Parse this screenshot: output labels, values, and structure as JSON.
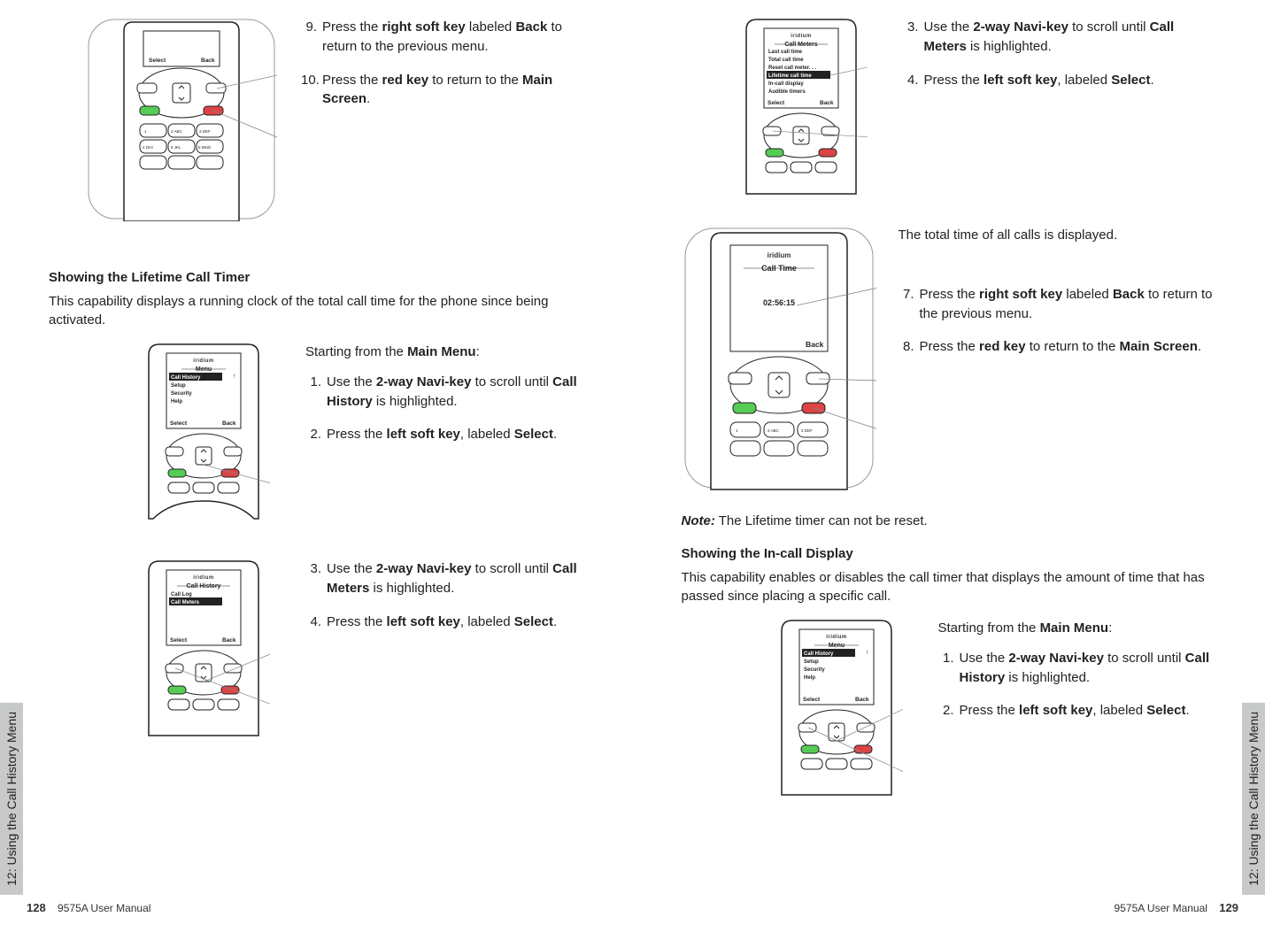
{
  "sideTab": "12: Using the Call History Menu",
  "manualTitle": "9575A User Manual",
  "pageLeftNum": "128",
  "pageRightNum": "129",
  "brand": "iridium",
  "softSelect": "Select",
  "softBack": "Back",
  "left": {
    "topPhone": {
      "step9": {
        "num": "9.",
        "pre": "Press the ",
        "b1": "right soft key",
        "mid": " labeled ",
        "b2": "Back",
        "post": " to return to the previous menu."
      },
      "step10": {
        "num": "10.",
        "pre": "Press the ",
        "b1": "red key",
        "mid": " to return to the ",
        "b2": "Main Screen",
        "post": "."
      }
    },
    "section1Title": "Showing the Lifetime Call Timer",
    "section1Body": "This capability displays a running clock of the total call time for the phone since being activated.",
    "menuTitle": "Menu",
    "menuItems": [
      "Call History",
      "Setup",
      "Security",
      "Help"
    ],
    "callHistoryTitle": "Call History",
    "callHistoryItems": [
      "Call Log",
      "Call Meters"
    ],
    "steps1": {
      "lead": {
        "pre": "Starting from the ",
        "b": "Main Menu",
        "post": ":"
      },
      "s1": {
        "num": "1.",
        "pre": "Use the ",
        "b1": "2-way Navi-key",
        "mid": " to scroll until ",
        "b2": "Call History",
        "post": " is highlighted."
      },
      "s2": {
        "num": "2.",
        "pre": "Press the ",
        "b1": "left soft key",
        "mid": ", labeled ",
        "b2": "Select",
        "post": "."
      }
    },
    "steps2": {
      "s3": {
        "num": "3.",
        "pre": "Use the ",
        "b1": "2-way Navi-key",
        "mid": " to scroll until ",
        "b2": "Call Meters",
        "post": " is highlighted."
      },
      "s4": {
        "num": "4.",
        "pre": "Press the ",
        "b1": "left soft key",
        "mid": ", labeled ",
        "b2": "Select",
        "post": "."
      }
    }
  },
  "right": {
    "callMetersTitle": "Call Meters",
    "callMetersItems": [
      "Last call time",
      "Total call time",
      "Reset call meter. . .",
      "Lifetime call time",
      "In-call display",
      "Audible timers"
    ],
    "callMetersHighlight": 3,
    "steps3": {
      "s3": {
        "num": "3.",
        "pre": "Use the ",
        "b1": "2-way Navi-key",
        "mid": " to scroll until ",
        "b2": "Call Meters",
        "post": " is highlighted."
      },
      "s4": {
        "num": "4.",
        "pre": "Press the ",
        "b1": "left soft key",
        "mid": ", labeled ",
        "b2": "Select",
        "post": "."
      }
    },
    "callTimeTitle": "Call Time",
    "callTimeValue": "02:56:15",
    "displayText": "The total time of all calls is displayed.",
    "step7": {
      "num": "7.",
      "pre": "Press the ",
      "b1": "right soft key",
      "mid": " labeled ",
      "b2": "Back",
      "post": " to return to the previous menu."
    },
    "step8": {
      "num": "8.",
      "pre": "Press the ",
      "b1": "red key",
      "mid": " to return to the ",
      "b2": "Main Screen",
      "post": "."
    },
    "noteLabel": "Note:",
    "noteText": " The Lifetime timer can not be reset.",
    "section2Title": "Showing the In-call Display",
    "section2Body": "This capability enables or disables the call timer that displays the amount of time that has passed since placing a specific call.",
    "steps4": {
      "lead": {
        "pre": "Starting from the ",
        "b": "Main Menu",
        "post": ":"
      },
      "s1": {
        "num": "1.",
        "pre": "Use the ",
        "b1": "2-way Navi-key",
        "mid": " to scroll until ",
        "b2": "Call History",
        "post": " is highlighted."
      },
      "s2": {
        "num": "2.",
        "pre": "Press the ",
        "b1": "left soft key",
        "mid": ", labeled ",
        "b2": "Select",
        "post": "."
      }
    }
  }
}
